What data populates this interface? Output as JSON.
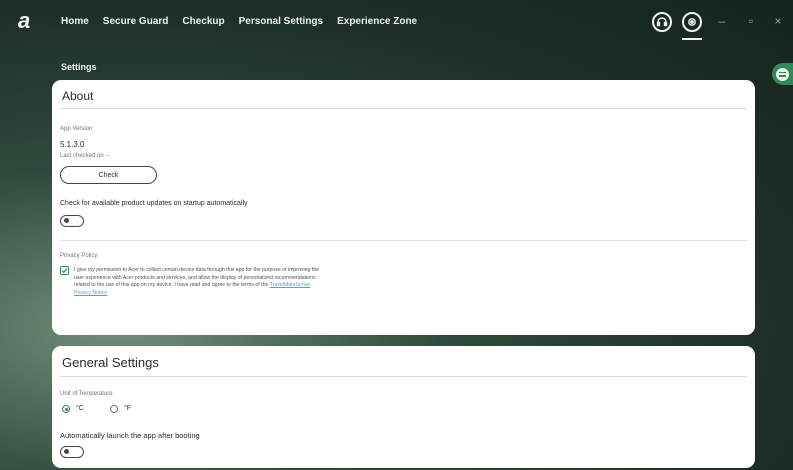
{
  "app": {
    "logo": "a",
    "nav": [
      "Home",
      "Secure Guard",
      "Checkup",
      "Personal Settings",
      "Experience Zone"
    ],
    "icons": {
      "support": "headset-icon",
      "settings": "gear-icon"
    },
    "window": {
      "minimize": "–",
      "maximize": "▫",
      "close": "×"
    }
  },
  "page": {
    "title": "Settings"
  },
  "about": {
    "title": "About",
    "app_version_label": "App Version",
    "app_version": "5.1.3.0",
    "last_checked": "Last checked on --",
    "check_button": "Check",
    "auto_update_label": "Check for available product updates on startup automatically",
    "auto_update_enabled": false,
    "privacy_label": "Privacy Policy",
    "privacy_checked": true,
    "privacy_text": "I give my permission to Acer to collect certain device data through this app for the purpose of improving the user experience with Acer products and services, and allow the display of personalized recommendations related to the use of this app on my device. I have read and agree to the terms of the ",
    "privacy_link": "TravelMateSense Privacy Notice"
  },
  "general": {
    "title": "General Settings",
    "temperature_label": "Unit of Temperature",
    "temperature_options": [
      "°C",
      "°F"
    ],
    "temperature_selected": "°C",
    "autolaunch_label": "Automatically launch the app after booting",
    "autolaunch_enabled": false
  },
  "colors": {
    "accent": "#2f8a5a",
    "link": "#5d9bd6"
  }
}
